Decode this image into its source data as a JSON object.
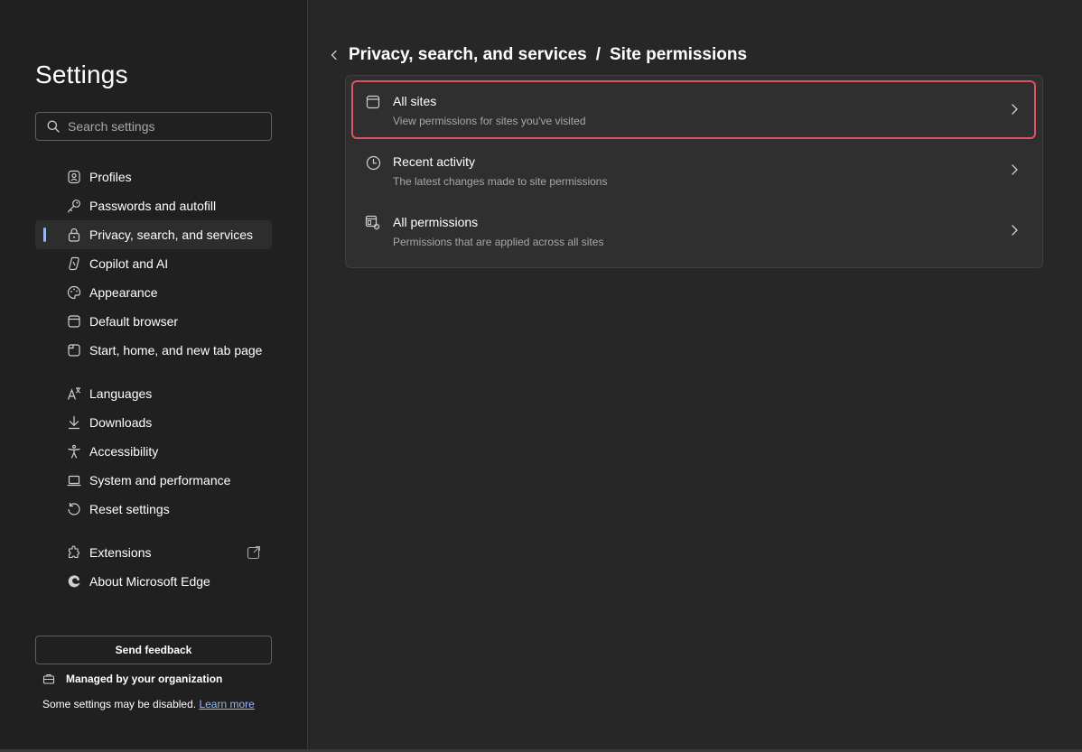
{
  "sidebar": {
    "title": "Settings",
    "search_placeholder": "Search settings",
    "items": [
      {
        "label": "Profiles",
        "icon": "profile-icon",
        "active": false
      },
      {
        "label": "Passwords and autofill",
        "icon": "key-icon",
        "active": false
      },
      {
        "label": "Privacy, search, and services",
        "icon": "lock-icon",
        "active": true
      },
      {
        "label": "Copilot and AI",
        "icon": "copilot-icon",
        "active": false
      },
      {
        "label": "Appearance",
        "icon": "palette-icon",
        "active": false
      },
      {
        "label": "Default browser",
        "icon": "browser-icon",
        "active": false
      },
      {
        "label": "Start, home, and new tab page",
        "icon": "home-tab-icon",
        "active": false
      },
      {
        "label": "Languages",
        "icon": "languages-icon",
        "active": false
      },
      {
        "label": "Downloads",
        "icon": "download-icon",
        "active": false
      },
      {
        "label": "Accessibility",
        "icon": "accessibility-icon",
        "active": false
      },
      {
        "label": "System and performance",
        "icon": "laptop-icon",
        "active": false
      },
      {
        "label": "Reset settings",
        "icon": "reset-icon",
        "active": false
      },
      {
        "label": "Extensions",
        "icon": "puzzle-icon",
        "active": false,
        "external": true
      },
      {
        "label": "About Microsoft Edge",
        "icon": "edge-icon",
        "active": false
      }
    ],
    "feedback_label": "Send feedback",
    "managed_label": "Managed by your organization",
    "disabled_note": "Some settings may be disabled.",
    "learn_more": "Learn more"
  },
  "breadcrumb": {
    "parent": "Privacy, search, and services",
    "separator": "/",
    "current": "Site permissions"
  },
  "permissions": [
    {
      "title": "All sites",
      "description": "View permissions for sites you've visited",
      "icon": "site-icon",
      "highlighted": true
    },
    {
      "title": "Recent activity",
      "description": "The latest changes made to site permissions",
      "icon": "clock-icon",
      "highlighted": false
    },
    {
      "title": "All permissions",
      "description": "Permissions that are applied across all sites",
      "icon": "permissions-icon",
      "highlighted": false
    }
  ],
  "colors": {
    "accent": "#9ab7f0",
    "highlight": "#e05261",
    "sidebar_bg": "#202020",
    "main_bg": "#272727",
    "card_bg": "#2f2f2f"
  }
}
